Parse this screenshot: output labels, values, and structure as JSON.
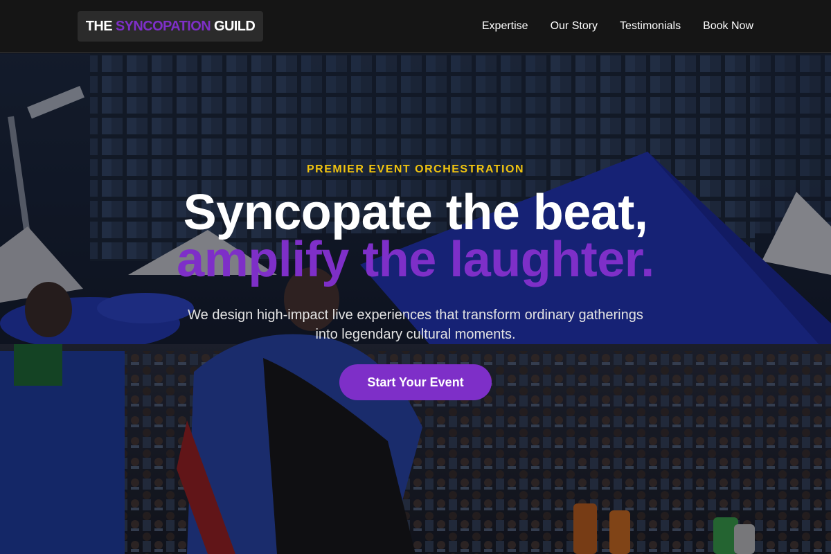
{
  "header": {
    "logo": {
      "prefix": "THE ",
      "accent": "SYNCOPATION",
      "suffix": " GUILD"
    },
    "nav": [
      "Expertise",
      "Our Story",
      "Testimonials",
      "Book Now"
    ]
  },
  "hero": {
    "eyebrow": "PREMIER EVENT ORCHESTRATION",
    "headline_line1": "Syncopate the beat,",
    "headline_line2": "amplify the laughter.",
    "subtext": "We design high-impact live experiences that transform ordinary gatherings into legendary cultural moments.",
    "cta_label": "Start Your Event"
  },
  "colors": {
    "accent": "#7e2fc8",
    "eyebrow": "#f1c40f",
    "header_bg": "#151515",
    "logo_bg": "#2b2b2b"
  },
  "icons": [
    "event-crowd-photo"
  ]
}
